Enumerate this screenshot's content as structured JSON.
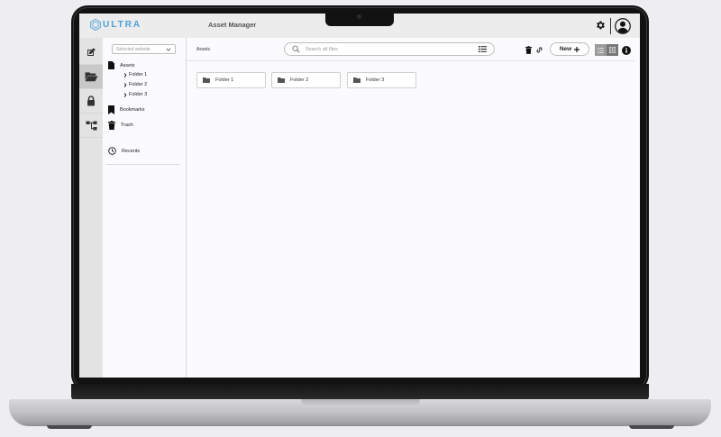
{
  "app": {
    "logo_text": "ULTRA",
    "title": "Asset Manager"
  },
  "rail": {
    "items": [
      {
        "name": "edit",
        "icon": "edit-icon",
        "active": false
      },
      {
        "name": "assets",
        "icon": "folder-open-icon",
        "active": true
      },
      {
        "name": "security",
        "icon": "lock-icon",
        "active": false
      },
      {
        "name": "structure",
        "icon": "sitemap-icon",
        "active": false
      }
    ]
  },
  "tree": {
    "site_select_placeholder": "Selected website",
    "assets_label": "Assets",
    "folders": [
      "Folder 1",
      "Folder 2",
      "Folder 3"
    ],
    "bookmarks_label": "Bookmarks",
    "trash_label": "Trash",
    "recents_label": "Recents"
  },
  "main": {
    "breadcrumb": "Assets",
    "search_placeholder": "Search all files",
    "new_button_label": "New",
    "folders": [
      {
        "label": "Folder 1"
      },
      {
        "label": "Folder 2"
      },
      {
        "label": "Folder 3"
      }
    ]
  },
  "colors": {
    "brand": "#4aa0d6",
    "active_rail": "#c8c8c8"
  }
}
